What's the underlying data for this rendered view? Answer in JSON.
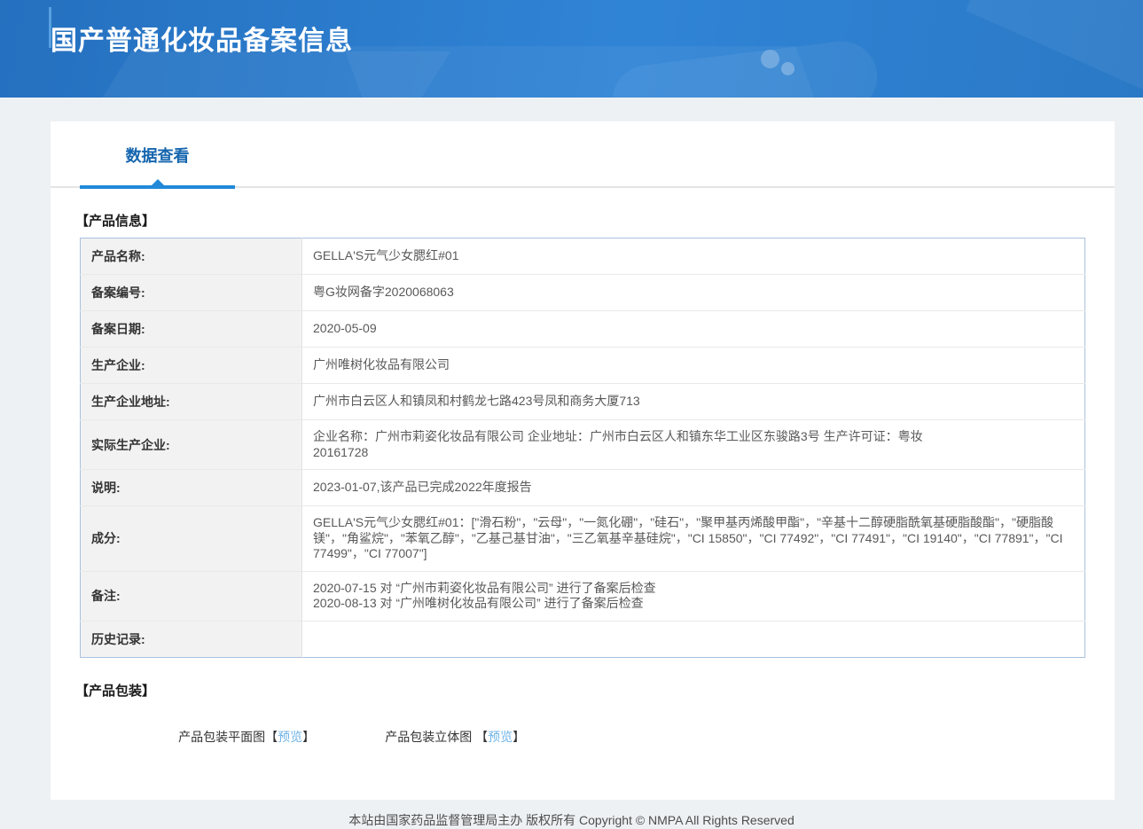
{
  "theme": {
    "accent_blue": "#2189d8",
    "tab_text_blue": "#1565ae",
    "link_blue": "#6fb3e8",
    "header_gradient": [
      "#2570bf",
      "#3084d6",
      "#2a79c6"
    ],
    "table_border": "#a9c1de",
    "label_cell_bg": "#f2f2f2"
  },
  "header": {
    "title": "国产普通化妆品备案信息"
  },
  "tabs": [
    {
      "label": "数据查看",
      "active": true
    }
  ],
  "sections": {
    "product_info": {
      "title": "【产品信息】",
      "rows": [
        {
          "label": "产品名称:",
          "value": "GELLA'S元气少女腮红#01"
        },
        {
          "label": "备案编号:",
          "value": "粤G妆网备字2020068063"
        },
        {
          "label": "备案日期:",
          "value": "2020-05-09"
        },
        {
          "label": "生产企业:",
          "value": "广州唯树化妆品有限公司"
        },
        {
          "label": "生产企业地址:",
          "value": "广州市白云区人和镇凤和村鹤龙七路423号凤和商务大厦713"
        },
        {
          "label": "实际生产企业:",
          "value": "企业名称：广州市莉姿化妆品有限公司 企业地址：广州市白云区人和镇东华工业区东骏路3号 生产许可证：粤妆\n20161728"
        },
        {
          "label": "说明:",
          "value": "2023-01-07,该产品已完成2022年度报告"
        },
        {
          "label": "成分:",
          "value": "GELLA'S元气少女腮红#01：[\"滑石粉\"，\"云母\"，\"一氮化硼\"，\"硅石\"，\"聚甲基丙烯酸甲酯\"，\"辛基十二醇硬脂酰氧基硬脂酸酯\"，\"硬脂酸镁\"，\"角鲨烷\"，\"苯氧乙醇\"，\"乙基己基甘油\"，\"三乙氧基辛基硅烷\"，\"CI 15850\"，\"CI 77492\"，\"CI 77491\"，\"CI 19140\"，\"CI 77891\"，\"CI 77499\"，\"CI 77007\"]"
        },
        {
          "label": "备注:",
          "value": "2020-07-15 对 “广州市莉姿化妆品有限公司” 进行了备案后检查\n2020-08-13 对 “广州唯树化妆品有限公司” 进行了备案后检查"
        },
        {
          "label": "历史记录:",
          "value": ""
        }
      ]
    },
    "packaging": {
      "title": "【产品包装】",
      "items": [
        {
          "label": "产品包装平面图",
          "open": "【",
          "link": "预览",
          "close": "】"
        },
        {
          "label": "产品包装立体图 ",
          "open": "【",
          "link": "预览",
          "close": "】"
        }
      ]
    }
  },
  "footer": {
    "text": "本站由国家药品监督管理局主办 版权所有 Copyright © NMPA All Rights Reserved"
  }
}
